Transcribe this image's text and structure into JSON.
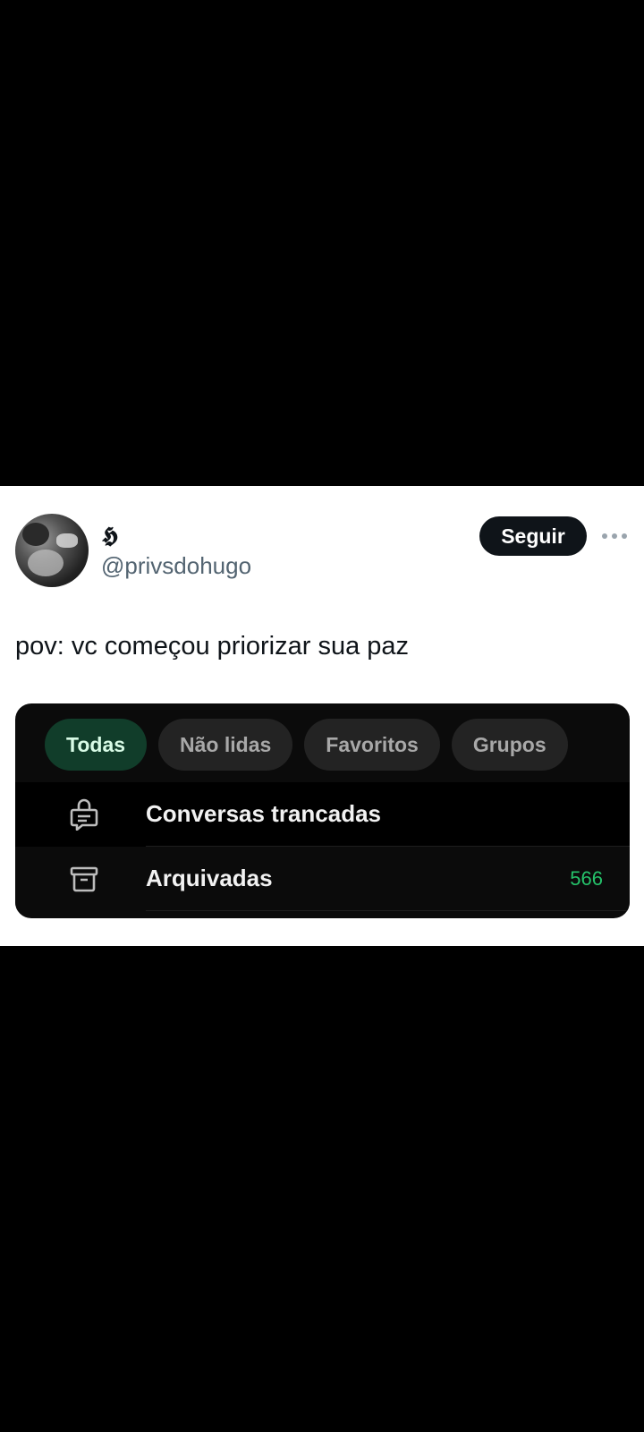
{
  "tweet": {
    "display_name": "𝕳",
    "handle": "@privsdohugo",
    "follow_label": "Seguir",
    "text": "pov: vc começou priorizar sua paz"
  },
  "embed": {
    "chips": [
      {
        "label": "Todas",
        "active": true
      },
      {
        "label": "Não lidas",
        "active": false
      },
      {
        "label": "Favoritos",
        "active": false
      },
      {
        "label": "Grupos",
        "active": false
      }
    ],
    "rows": [
      {
        "icon": "locked-chat-icon",
        "label": "Conversas trancadas",
        "count": ""
      },
      {
        "icon": "archive-icon",
        "label": "Arquivadas",
        "count": "566"
      }
    ],
    "accent_green": "#25c26a",
    "active_chip_bg": "#113d2a"
  }
}
